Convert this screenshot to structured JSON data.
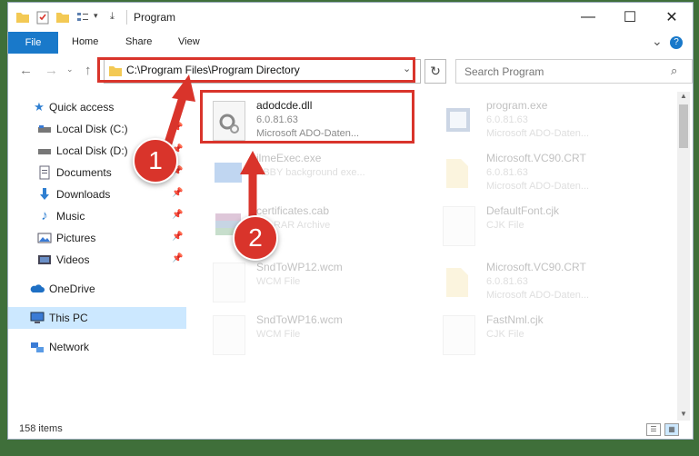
{
  "window": {
    "title": "Program",
    "minimize_glyph": "—",
    "maximize_glyph": "☐",
    "close_glyph": "✕"
  },
  "ribbon": {
    "tabs": [
      "File",
      "Home",
      "Share",
      "View"
    ],
    "expand_glyph": "⌄",
    "help_glyph": "?"
  },
  "address": {
    "path": "C:\\Program Files\\Program Directory",
    "dropdown_glyph": "⌄",
    "refresh_glyph": "↻"
  },
  "search": {
    "placeholder": "Search Program",
    "icon": "search-icon"
  },
  "nav_pane": {
    "items": [
      {
        "label": "Quick access",
        "icon": "star-icon",
        "pinned": false
      },
      {
        "label": "Local Disk (C:)",
        "icon": "drive-icon",
        "pinned": true
      },
      {
        "label": "Local Disk (D:)",
        "icon": "drive-icon",
        "pinned": true
      },
      {
        "label": "Documents",
        "icon": "documents-icon",
        "pinned": true
      },
      {
        "label": "Downloads",
        "icon": "downloads-icon",
        "pinned": true
      },
      {
        "label": "Music",
        "icon": "music-icon",
        "pinned": true
      },
      {
        "label": "Pictures",
        "icon": "pictures-icon",
        "pinned": true
      },
      {
        "label": "Videos",
        "icon": "videos-icon",
        "pinned": true
      },
      {
        "label": "OneDrive",
        "icon": "cloud-icon",
        "pinned": false
      },
      {
        "label": "This PC",
        "icon": "computer-icon",
        "pinned": false,
        "selected": true
      },
      {
        "label": "Network",
        "icon": "network-icon",
        "pinned": false
      }
    ]
  },
  "files": [
    {
      "name": "adodcde.dll",
      "line1": "6.0.81.63",
      "line2": "Microsoft ADO-Daten...",
      "icon": "dll-gear-icon",
      "highlighted": true
    },
    {
      "name": "program.exe",
      "line1": "6.0.81.63",
      "line2": "Microsoft ADO-Daten...",
      "icon": "exe-icon"
    },
    {
      "name": "ilmeExec.exe",
      "line1": "ABBY background exe...",
      "line2": "",
      "icon": "exe-icon"
    },
    {
      "name": "Microsoft.VC90.CRT",
      "line1": "6.0.81.63",
      "line2": "Microsoft ADO-Daten...",
      "icon": "folder-icon"
    },
    {
      "name": "certificates.cab",
      "line1": "WinRAR Archive",
      "line2": "",
      "icon": "archive-icon"
    },
    {
      "name": "DefaultFont.cjk",
      "line1": "CJK File",
      "line2": "",
      "icon": "file-icon"
    },
    {
      "name": "SndToWP12.wcm",
      "line1": "WCM File",
      "line2": "",
      "icon": "file-icon"
    },
    {
      "name": "Microsoft.VC90.CRT",
      "line1": "6.0.81.63",
      "line2": "Microsoft ADO-Daten...",
      "icon": "folder-icon"
    },
    {
      "name": "SndToWP16.wcm",
      "line1": "WCM File",
      "line2": "",
      "icon": "file-icon"
    },
    {
      "name": "FastNml.cjk",
      "line1": "CJK File",
      "line2": "",
      "icon": "file-icon"
    }
  ],
  "status": {
    "item_count": "158 items"
  },
  "markers": {
    "step1": "1",
    "step2": "2"
  },
  "colors": {
    "accent": "#1979ca",
    "highlight_red": "#d9342b",
    "selection": "#cce8ff"
  }
}
